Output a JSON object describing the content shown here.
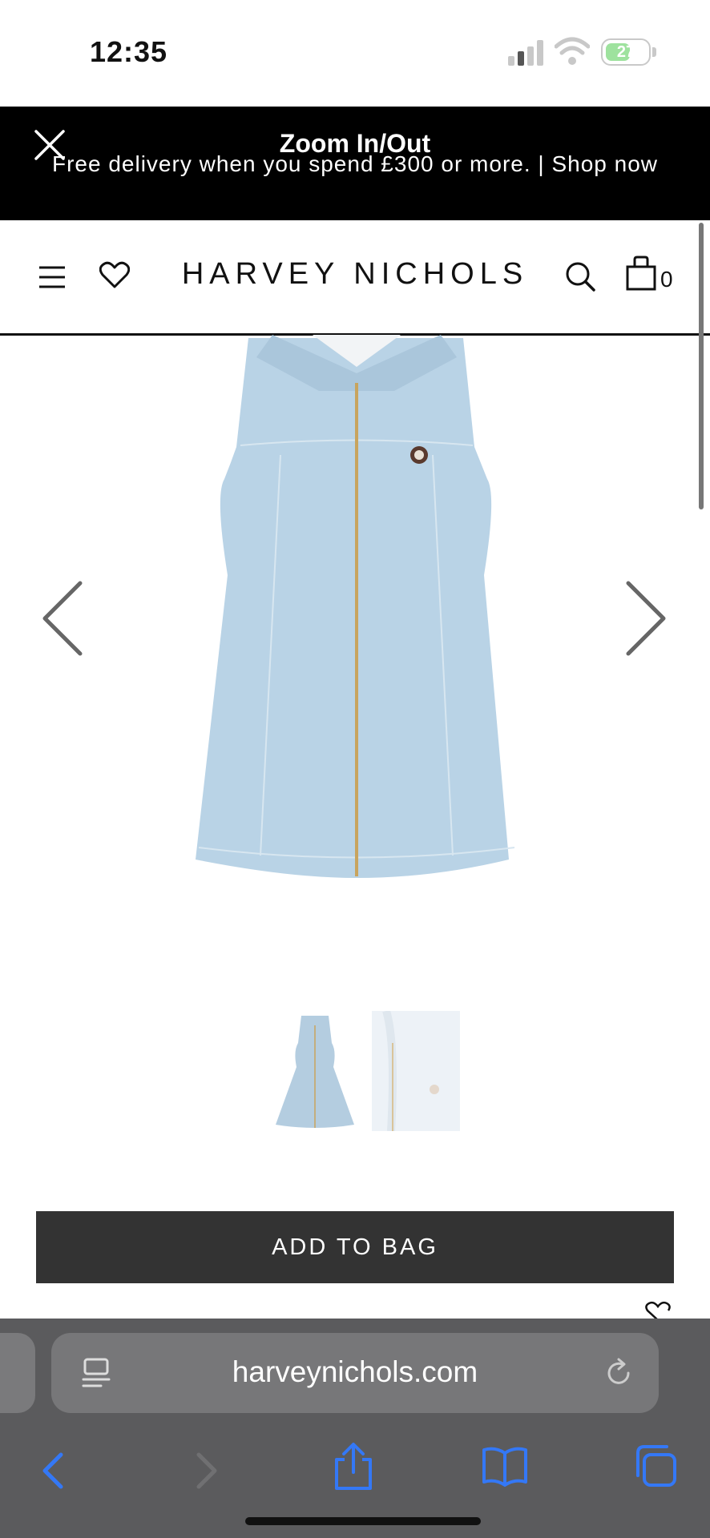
{
  "status_bar": {
    "time": "12:35",
    "battery": "27"
  },
  "banner": {
    "zoom_label": "Zoom In/Out",
    "promo_text": "Free delivery when you spend £300 or more. | Shop now"
  },
  "header": {
    "logo": "HARVEY NICHOLS",
    "bag_count": "0"
  },
  "product": {
    "image": "denim-sleeveless-zip-dress",
    "thumbnails": [
      "dress-front-thumbnail",
      "collar-detail-thumbnail"
    ]
  },
  "actions": {
    "add_to_bag": "ADD TO BAG"
  },
  "browser": {
    "url": "harveynichols.com"
  },
  "colors": {
    "banner_bg": "#000000",
    "button_bg": "#333333",
    "dress_denim": "#b9d3e6",
    "browser_bar": "#5b5b5d",
    "ios_blue": "#3478f6"
  }
}
